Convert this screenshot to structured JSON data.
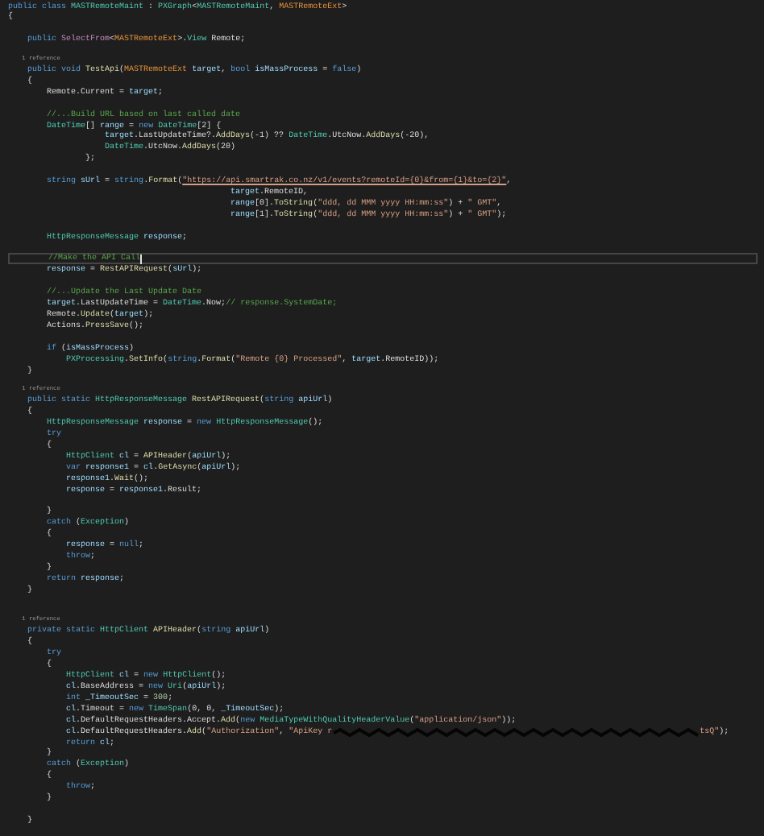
{
  "editor": {
    "lines": [
      {
        "kind": "code",
        "tokens": [
          {
            "kind": "kw",
            "text": "public class "
          },
          {
            "kind": "type",
            "text": "MASTRemoteMaint"
          },
          {
            "kind": "txt",
            "text": " : "
          },
          {
            "kind": "type",
            "text": "PXGraph"
          },
          {
            "kind": "txt",
            "text": "<"
          },
          {
            "kind": "type",
            "text": "MASTRemoteMaint"
          },
          {
            "kind": "txt",
            "text": ", "
          },
          {
            "kind": "cls",
            "text": "MASTRemoteExt"
          },
          {
            "kind": "txt",
            "text": ">"
          }
        ]
      },
      {
        "kind": "code",
        "tokens": [
          {
            "kind": "txt",
            "text": "{"
          }
        ]
      },
      {
        "kind": "blank"
      },
      {
        "kind": "code",
        "tokens": [
          {
            "kind": "kw",
            "text": "    public "
          },
          {
            "kind": "pur",
            "text": "SelectFrom"
          },
          {
            "kind": "txt",
            "text": "<"
          },
          {
            "kind": "cls",
            "text": "MASTRemoteExt"
          },
          {
            "kind": "txt",
            "text": ">."
          },
          {
            "kind": "type",
            "text": "View"
          },
          {
            "kind": "txt",
            "text": " Remote;"
          }
        ]
      },
      {
        "kind": "blank"
      },
      {
        "kind": "codelens",
        "text": "    1 reference"
      },
      {
        "kind": "code",
        "tokens": [
          {
            "kind": "kw",
            "text": "    public void "
          },
          {
            "kind": "fn",
            "text": "TestApi"
          },
          {
            "kind": "txt",
            "text": "("
          },
          {
            "kind": "cls",
            "text": "MASTRemoteExt"
          },
          {
            "kind": "id",
            "text": " target"
          },
          {
            "kind": "txt",
            "text": ", "
          },
          {
            "kind": "kw",
            "text": "bool "
          },
          {
            "kind": "id",
            "text": "isMassProcess"
          },
          {
            "kind": "txt",
            "text": " = "
          },
          {
            "kind": "kw",
            "text": "false"
          },
          {
            "kind": "txt",
            "text": ")"
          }
        ]
      },
      {
        "kind": "code",
        "tokens": [
          {
            "kind": "txt",
            "text": "    {"
          }
        ]
      },
      {
        "kind": "code",
        "tokens": [
          {
            "kind": "txt",
            "text": "        Remote.Current = "
          },
          {
            "kind": "id",
            "text": "target"
          },
          {
            "kind": "txt",
            "text": ";"
          }
        ]
      },
      {
        "kind": "blank"
      },
      {
        "kind": "code",
        "tokens": [
          {
            "kind": "cmt",
            "text": "        //...Build URL based on last called date"
          }
        ]
      },
      {
        "kind": "code",
        "tokens": [
          {
            "kind": "type",
            "text": "        DateTime"
          },
          {
            "kind": "txt",
            "text": "[] "
          },
          {
            "kind": "id",
            "text": "range"
          },
          {
            "kind": "txt",
            "text": " = "
          },
          {
            "kind": "kw",
            "text": "new "
          },
          {
            "kind": "type",
            "text": "DateTime"
          },
          {
            "kind": "txt",
            "text": "[2] {"
          }
        ]
      },
      {
        "kind": "code",
        "tokens": [
          {
            "kind": "id",
            "text": "                    target"
          },
          {
            "kind": "txt",
            "text": ".LastUpdateTime?."
          },
          {
            "kind": "fn",
            "text": "AddDays"
          },
          {
            "kind": "txt",
            "text": "(-1) ?? "
          },
          {
            "kind": "type",
            "text": "DateTime"
          },
          {
            "kind": "txt",
            "text": ".UtcNow."
          },
          {
            "kind": "fn",
            "text": "AddDays"
          },
          {
            "kind": "txt",
            "text": "(-20),"
          }
        ]
      },
      {
        "kind": "code",
        "tokens": [
          {
            "kind": "type",
            "text": "                    DateTime"
          },
          {
            "kind": "txt",
            "text": ".UtcNow."
          },
          {
            "kind": "fn",
            "text": "AddDays"
          },
          {
            "kind": "txt",
            "text": "(20)"
          }
        ]
      },
      {
        "kind": "code",
        "tokens": [
          {
            "kind": "txt",
            "text": "                };"
          }
        ]
      },
      {
        "kind": "blank"
      },
      {
        "kind": "code",
        "tokens": [
          {
            "kind": "kw",
            "text": "        string "
          },
          {
            "kind": "id",
            "text": "sUrl"
          },
          {
            "kind": "txt",
            "text": " = "
          },
          {
            "kind": "kw",
            "text": "string"
          },
          {
            "kind": "txt",
            "text": "."
          },
          {
            "kind": "fn",
            "text": "Format"
          },
          {
            "kind": "txt",
            "text": "("
          },
          {
            "kind": "url",
            "text": "\"https://api.smartrak.co.nz/v1/events?remoteId={0}&from={1}&to={2}\""
          },
          {
            "kind": "txt",
            "text": ","
          }
        ]
      },
      {
        "kind": "code",
        "tokens": [
          {
            "kind": "id",
            "text": "                                              target"
          },
          {
            "kind": "txt",
            "text": ".RemoteID,"
          }
        ]
      },
      {
        "kind": "code",
        "tokens": [
          {
            "kind": "id",
            "text": "                                              range"
          },
          {
            "kind": "txt",
            "text": "[0]."
          },
          {
            "kind": "fn",
            "text": "ToString"
          },
          {
            "kind": "txt",
            "text": "("
          },
          {
            "kind": "str",
            "text": "\"ddd, dd MMM yyyy HH:mm:ss\""
          },
          {
            "kind": "txt",
            "text": ") + "
          },
          {
            "kind": "str",
            "text": "\" GMT\""
          },
          {
            "kind": "txt",
            "text": ","
          }
        ]
      },
      {
        "kind": "code",
        "tokens": [
          {
            "kind": "id",
            "text": "                                              range"
          },
          {
            "kind": "txt",
            "text": "[1]."
          },
          {
            "kind": "fn",
            "text": "ToString"
          },
          {
            "kind": "txt",
            "text": "("
          },
          {
            "kind": "str",
            "text": "\"ddd, dd MMM yyyy HH:mm:ss\""
          },
          {
            "kind": "txt",
            "text": ") + "
          },
          {
            "kind": "str",
            "text": "\" GMT\""
          },
          {
            "kind": "txt",
            "text": ");"
          }
        ]
      },
      {
        "kind": "blank"
      },
      {
        "kind": "code",
        "tokens": [
          {
            "kind": "type",
            "text": "        HttpResponseMessage"
          },
          {
            "kind": "id",
            "text": " response"
          },
          {
            "kind": "txt",
            "text": ";"
          }
        ]
      },
      {
        "kind": "blank"
      },
      {
        "kind": "code",
        "current": true,
        "tokens": [
          {
            "kind": "cmt",
            "text": "        //Make the API Call"
          }
        ]
      },
      {
        "kind": "code",
        "tokens": [
          {
            "kind": "id",
            "text": "        response"
          },
          {
            "kind": "txt",
            "text": " = "
          },
          {
            "kind": "fn",
            "text": "RestAPIRequest"
          },
          {
            "kind": "txt",
            "text": "("
          },
          {
            "kind": "id",
            "text": "sUrl"
          },
          {
            "kind": "txt",
            "text": ");"
          }
        ]
      },
      {
        "kind": "blank"
      },
      {
        "kind": "code",
        "tokens": [
          {
            "kind": "cmt",
            "text": "        //...Update the Last Update Date"
          }
        ]
      },
      {
        "kind": "code",
        "tokens": [
          {
            "kind": "id",
            "text": "        target"
          },
          {
            "kind": "txt",
            "text": ".LastUpdateTime = "
          },
          {
            "kind": "type",
            "text": "DateTime"
          },
          {
            "kind": "txt",
            "text": ".Now;"
          },
          {
            "kind": "cmt",
            "text": "// response.SystemDate;"
          }
        ]
      },
      {
        "kind": "code",
        "tokens": [
          {
            "kind": "txt",
            "text": "        Remote."
          },
          {
            "kind": "fn",
            "text": "Update"
          },
          {
            "kind": "txt",
            "text": "("
          },
          {
            "kind": "id",
            "text": "target"
          },
          {
            "kind": "txt",
            "text": ");"
          }
        ]
      },
      {
        "kind": "code",
        "tokens": [
          {
            "kind": "txt",
            "text": "        Actions."
          },
          {
            "kind": "fn",
            "text": "PressSave"
          },
          {
            "kind": "txt",
            "text": "();"
          }
        ]
      },
      {
        "kind": "blank"
      },
      {
        "kind": "code",
        "tokens": [
          {
            "kind": "kw",
            "text": "        if "
          },
          {
            "kind": "txt",
            "text": "("
          },
          {
            "kind": "id",
            "text": "isMassProcess"
          },
          {
            "kind": "txt",
            "text": ")"
          }
        ]
      },
      {
        "kind": "code",
        "tokens": [
          {
            "kind": "type",
            "text": "            PXProcessing"
          },
          {
            "kind": "txt",
            "text": "."
          },
          {
            "kind": "fn",
            "text": "SetInfo"
          },
          {
            "kind": "txt",
            "text": "("
          },
          {
            "kind": "kw",
            "text": "string"
          },
          {
            "kind": "txt",
            "text": "."
          },
          {
            "kind": "fn",
            "text": "Format"
          },
          {
            "kind": "txt",
            "text": "("
          },
          {
            "kind": "str",
            "text": "\"Remote {0} Processed\""
          },
          {
            "kind": "txt",
            "text": ", "
          },
          {
            "kind": "id",
            "text": "target"
          },
          {
            "kind": "txt",
            "text": ".RemoteID));"
          }
        ]
      },
      {
        "kind": "code",
        "tokens": [
          {
            "kind": "txt",
            "text": "    }"
          }
        ]
      },
      {
        "kind": "blank"
      },
      {
        "kind": "codelens",
        "text": "    1 reference"
      },
      {
        "kind": "code",
        "tokens": [
          {
            "kind": "kw",
            "text": "    public static "
          },
          {
            "kind": "type",
            "text": "HttpResponseMessage"
          },
          {
            "kind": "fn",
            "text": " RestAPIRequest"
          },
          {
            "kind": "txt",
            "text": "("
          },
          {
            "kind": "kw",
            "text": "string "
          },
          {
            "kind": "id",
            "text": "apiUrl"
          },
          {
            "kind": "txt",
            "text": ")"
          }
        ]
      },
      {
        "kind": "code",
        "tokens": [
          {
            "kind": "txt",
            "text": "    {"
          }
        ]
      },
      {
        "kind": "code",
        "tokens": [
          {
            "kind": "type",
            "text": "        HttpResponseMessage"
          },
          {
            "kind": "id",
            "text": " response"
          },
          {
            "kind": "txt",
            "text": " = "
          },
          {
            "kind": "kw",
            "text": "new "
          },
          {
            "kind": "type",
            "text": "HttpResponseMessage"
          },
          {
            "kind": "txt",
            "text": "();"
          }
        ]
      },
      {
        "kind": "code",
        "tokens": [
          {
            "kind": "kw",
            "text": "        try"
          }
        ]
      },
      {
        "kind": "code",
        "tokens": [
          {
            "kind": "txt",
            "text": "        {"
          }
        ]
      },
      {
        "kind": "code",
        "tokens": [
          {
            "kind": "type",
            "text": "            HttpClient"
          },
          {
            "kind": "id",
            "text": " cl"
          },
          {
            "kind": "txt",
            "text": " = "
          },
          {
            "kind": "fn",
            "text": "APIHeader"
          },
          {
            "kind": "txt",
            "text": "("
          },
          {
            "kind": "id",
            "text": "apiUrl"
          },
          {
            "kind": "txt",
            "text": ");"
          }
        ]
      },
      {
        "kind": "code",
        "tokens": [
          {
            "kind": "kw",
            "text": "            var "
          },
          {
            "kind": "id",
            "text": "response1"
          },
          {
            "kind": "txt",
            "text": " = "
          },
          {
            "kind": "id",
            "text": "cl"
          },
          {
            "kind": "txt",
            "text": "."
          },
          {
            "kind": "fn",
            "text": "GetAsync"
          },
          {
            "kind": "txt",
            "text": "("
          },
          {
            "kind": "id",
            "text": "apiUrl"
          },
          {
            "kind": "txt",
            "text": ");"
          }
        ]
      },
      {
        "kind": "code",
        "tokens": [
          {
            "kind": "id",
            "text": "            response1"
          },
          {
            "kind": "txt",
            "text": "."
          },
          {
            "kind": "fn",
            "text": "Wait"
          },
          {
            "kind": "txt",
            "text": "();"
          }
        ]
      },
      {
        "kind": "code",
        "tokens": [
          {
            "kind": "id",
            "text": "            response"
          },
          {
            "kind": "txt",
            "text": " = "
          },
          {
            "kind": "id",
            "text": "response1"
          },
          {
            "kind": "txt",
            "text": ".Result;"
          }
        ]
      },
      {
        "kind": "blank"
      },
      {
        "kind": "code",
        "tokens": [
          {
            "kind": "txt",
            "text": "        }"
          }
        ]
      },
      {
        "kind": "code",
        "tokens": [
          {
            "kind": "kw",
            "text": "        catch "
          },
          {
            "kind": "txt",
            "text": "("
          },
          {
            "kind": "type",
            "text": "Exception"
          },
          {
            "kind": "txt",
            "text": ")"
          }
        ]
      },
      {
        "kind": "code",
        "tokens": [
          {
            "kind": "txt",
            "text": "        {"
          }
        ]
      },
      {
        "kind": "code",
        "tokens": [
          {
            "kind": "id",
            "text": "            response"
          },
          {
            "kind": "txt",
            "text": " = "
          },
          {
            "kind": "kw",
            "text": "null"
          },
          {
            "kind": "txt",
            "text": ";"
          }
        ]
      },
      {
        "kind": "code",
        "tokens": [
          {
            "kind": "kw",
            "text": "            throw"
          },
          {
            "kind": "txt",
            "text": ";"
          }
        ]
      },
      {
        "kind": "code",
        "tokens": [
          {
            "kind": "txt",
            "text": "        }"
          }
        ]
      },
      {
        "kind": "code",
        "tokens": [
          {
            "kind": "kw",
            "text": "        return "
          },
          {
            "kind": "id",
            "text": "response"
          },
          {
            "kind": "txt",
            "text": ";"
          }
        ]
      },
      {
        "kind": "code",
        "tokens": [
          {
            "kind": "txt",
            "text": "    }"
          }
        ]
      },
      {
        "kind": "blank"
      },
      {
        "kind": "blank"
      },
      {
        "kind": "codelens",
        "text": "    1 reference"
      },
      {
        "kind": "code",
        "tokens": [
          {
            "kind": "kw",
            "text": "    private static "
          },
          {
            "kind": "type",
            "text": "HttpClient"
          },
          {
            "kind": "fn",
            "text": " APIHeader"
          },
          {
            "kind": "txt",
            "text": "("
          },
          {
            "kind": "kw",
            "text": "string "
          },
          {
            "kind": "id",
            "text": "apiUrl"
          },
          {
            "kind": "txt",
            "text": ")"
          }
        ]
      },
      {
        "kind": "code",
        "tokens": [
          {
            "kind": "txt",
            "text": "    {"
          }
        ]
      },
      {
        "kind": "code",
        "tokens": [
          {
            "kind": "kw",
            "text": "        try"
          }
        ]
      },
      {
        "kind": "code",
        "tokens": [
          {
            "kind": "txt",
            "text": "        {"
          }
        ]
      },
      {
        "kind": "code",
        "tokens": [
          {
            "kind": "type",
            "text": "            HttpClient"
          },
          {
            "kind": "id",
            "text": " cl"
          },
          {
            "kind": "txt",
            "text": " = "
          },
          {
            "kind": "kw",
            "text": "new "
          },
          {
            "kind": "type",
            "text": "HttpClient"
          },
          {
            "kind": "txt",
            "text": "();"
          }
        ]
      },
      {
        "kind": "code",
        "tokens": [
          {
            "kind": "id",
            "text": "            cl"
          },
          {
            "kind": "txt",
            "text": ".BaseAddress = "
          },
          {
            "kind": "kw",
            "text": "new "
          },
          {
            "kind": "type",
            "text": "Uri"
          },
          {
            "kind": "txt",
            "text": "("
          },
          {
            "kind": "id",
            "text": "apiUrl"
          },
          {
            "kind": "txt",
            "text": ");"
          }
        ]
      },
      {
        "kind": "code",
        "tokens": [
          {
            "kind": "kw",
            "text": "            int "
          },
          {
            "kind": "id",
            "text": "_TimeoutSec"
          },
          {
            "kind": "txt",
            "text": " = "
          },
          {
            "kind": "num",
            "text": "300"
          },
          {
            "kind": "txt",
            "text": ";"
          }
        ]
      },
      {
        "kind": "code",
        "tokens": [
          {
            "kind": "id",
            "text": "            cl"
          },
          {
            "kind": "txt",
            "text": ".Timeout = "
          },
          {
            "kind": "kw",
            "text": "new "
          },
          {
            "kind": "type",
            "text": "TimeSpan"
          },
          {
            "kind": "txt",
            "text": "(0, 0, "
          },
          {
            "kind": "id",
            "text": "_TimeoutSec"
          },
          {
            "kind": "txt",
            "text": ");"
          }
        ]
      },
      {
        "kind": "code",
        "tokens": [
          {
            "kind": "id",
            "text": "            cl"
          },
          {
            "kind": "txt",
            "text": ".DefaultRequestHeaders.Accept."
          },
          {
            "kind": "fn",
            "text": "Add"
          },
          {
            "kind": "txt",
            "text": "("
          },
          {
            "kind": "kw",
            "text": "new "
          },
          {
            "kind": "type",
            "text": "MediaTypeWithQualityHeaderValue"
          },
          {
            "kind": "txt",
            "text": "("
          },
          {
            "kind": "str",
            "text": "\"application/json\""
          },
          {
            "kind": "txt",
            "text": "));"
          }
        ]
      },
      {
        "kind": "code",
        "tokens": [
          {
            "kind": "id",
            "text": "            cl"
          },
          {
            "kind": "txt",
            "text": ".DefaultRequestHeaders."
          },
          {
            "kind": "fn",
            "text": "Add"
          },
          {
            "kind": "txt",
            "text": "("
          },
          {
            "kind": "str",
            "text": "\"Authorization\""
          },
          {
            "kind": "txt",
            "text": ", "
          },
          {
            "kind": "str",
            "text": "\"ApiKey r"
          },
          {
            "kind": "redaction"
          },
          {
            "kind": "str",
            "text": "tsQ\""
          },
          {
            "kind": "txt",
            "text": ");"
          }
        ]
      },
      {
        "kind": "code",
        "tokens": [
          {
            "kind": "kw",
            "text": "            return "
          },
          {
            "kind": "id",
            "text": "cl"
          },
          {
            "kind": "txt",
            "text": ";"
          }
        ]
      },
      {
        "kind": "code",
        "tokens": [
          {
            "kind": "txt",
            "text": "        }"
          }
        ]
      },
      {
        "kind": "code",
        "tokens": [
          {
            "kind": "kw",
            "text": "        catch "
          },
          {
            "kind": "txt",
            "text": "("
          },
          {
            "kind": "type",
            "text": "Exception"
          },
          {
            "kind": "txt",
            "text": ")"
          }
        ]
      },
      {
        "kind": "code",
        "tokens": [
          {
            "kind": "txt",
            "text": "        {"
          }
        ]
      },
      {
        "kind": "code",
        "tokens": [
          {
            "kind": "kw",
            "text": "            throw"
          },
          {
            "kind": "txt",
            "text": ";"
          }
        ]
      },
      {
        "kind": "code",
        "tokens": [
          {
            "kind": "txt",
            "text": "        }"
          }
        ]
      },
      {
        "kind": "blank"
      },
      {
        "kind": "code",
        "tokens": [
          {
            "kind": "txt",
            "text": "    }"
          }
        ]
      }
    ]
  }
}
